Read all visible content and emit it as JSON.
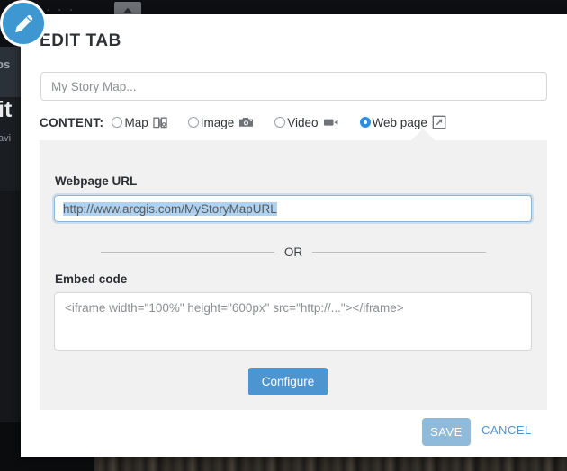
{
  "background": {
    "text_fragments": [
      "bs",
      "it",
      "avi"
    ],
    "topbar_dots": "· · ·",
    "overlay_color": "#15171a"
  },
  "modal": {
    "icon": "pencil-icon",
    "title": "EDIT TAB",
    "title_field": {
      "value": "",
      "placeholder": "My Story Map..."
    },
    "content": {
      "label": "CONTENT:",
      "options": [
        {
          "label": "Map",
          "icon": "map-icon",
          "selected": false
        },
        {
          "label": "Image",
          "icon": "camera-icon",
          "selected": false
        },
        {
          "label": "Video",
          "icon": "video-camera-icon",
          "selected": false
        },
        {
          "label": "Web page",
          "icon": "external-link-icon",
          "selected": true
        }
      ]
    },
    "panel": {
      "url_label": "Webpage URL",
      "url_value": "http://www.arcgis.com/MyStoryMapURL",
      "url_selected": true,
      "divider_text": "OR",
      "embed_label": "Embed code",
      "embed_value": "",
      "embed_placeholder": "<iframe width=\"100%\" height=\"600px\" src=\"http://...\"></iframe>",
      "configure_label": "Configure"
    },
    "footer": {
      "save_label": "SAVE",
      "cancel_label": "CANCEL"
    }
  },
  "colors": {
    "accent_blue": "#4d95d0",
    "badge_blue": "#3e97d1",
    "radio_selected": "#2a8fe0",
    "save_disabled": "#8fbada",
    "panel_bg": "#f1f1f1",
    "selection_blue": "#aed2f0"
  }
}
